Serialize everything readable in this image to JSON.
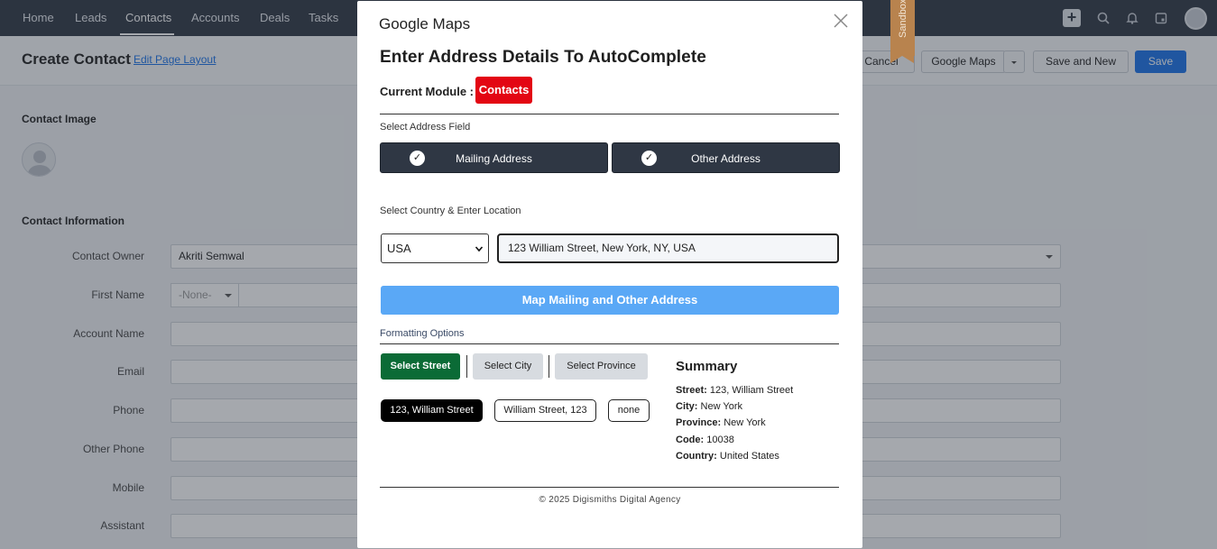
{
  "topnav": {
    "items": [
      "Home",
      "Leads",
      "Contacts",
      "Accounts",
      "Deals",
      "Tasks"
    ],
    "active": "Contacts"
  },
  "header": {
    "title": "Create Contact",
    "edit_layout": "Edit Page Layout",
    "cancel": "Cancel",
    "google_maps": "Google Maps",
    "save_and_new": "Save and New",
    "save": "Save"
  },
  "form": {
    "contact_image_title": "Contact Image",
    "contact_info_title": "Contact Information",
    "fields": [
      {
        "label": "Contact Owner",
        "value": "Akriti Semwal"
      },
      {
        "label": "First Name",
        "value": ""
      },
      {
        "label": "Account Name",
        "value": ""
      },
      {
        "label": "Email",
        "value": ""
      },
      {
        "label": "Phone",
        "value": ""
      },
      {
        "label": "Other Phone",
        "value": ""
      },
      {
        "label": "Mobile",
        "value": ""
      },
      {
        "label": "Assistant",
        "value": ""
      }
    ],
    "salutation": "-None-"
  },
  "modal": {
    "title": "Google Maps",
    "ribbon": "Sandbox",
    "heading": "Enter Address Details To AutoComplete",
    "module_label": "Current Module :",
    "module_value": "Contacts",
    "select_address_label": "Select Address Field",
    "address_buttons": [
      "Mailing Address",
      "Other Address"
    ],
    "country_label": "Select Country & Enter Location",
    "country": "USA",
    "location": "123 William Street, New York, NY, USA",
    "map_button": "Map Mailing and Other Address",
    "formatting_label": "Formatting Options",
    "format_buttons": [
      "Select Street",
      "Select City",
      "Select Province"
    ],
    "street_formats": [
      "123, William Street",
      "William Street, 123",
      "none"
    ],
    "summary": {
      "title": "Summary",
      "rows": [
        {
          "key": "Street:",
          "value": "123, William Street"
        },
        {
          "key": "City:",
          "value": "New York"
        },
        {
          "key": "Province:",
          "value": "New York"
        },
        {
          "key": "Code:",
          "value": "10038"
        },
        {
          "key": "Country:",
          "value": "United States"
        }
      ]
    },
    "footer": "© 2025 Digismiths Digital Agency"
  },
  "colors": {
    "nav_bg": "#2f3744",
    "module_badge": "#e30613",
    "map_button": "#5aa8f6",
    "select_street_active": "#0b6b36",
    "primary_blue": "#1a73e8",
    "ribbon": "#b8834e"
  }
}
